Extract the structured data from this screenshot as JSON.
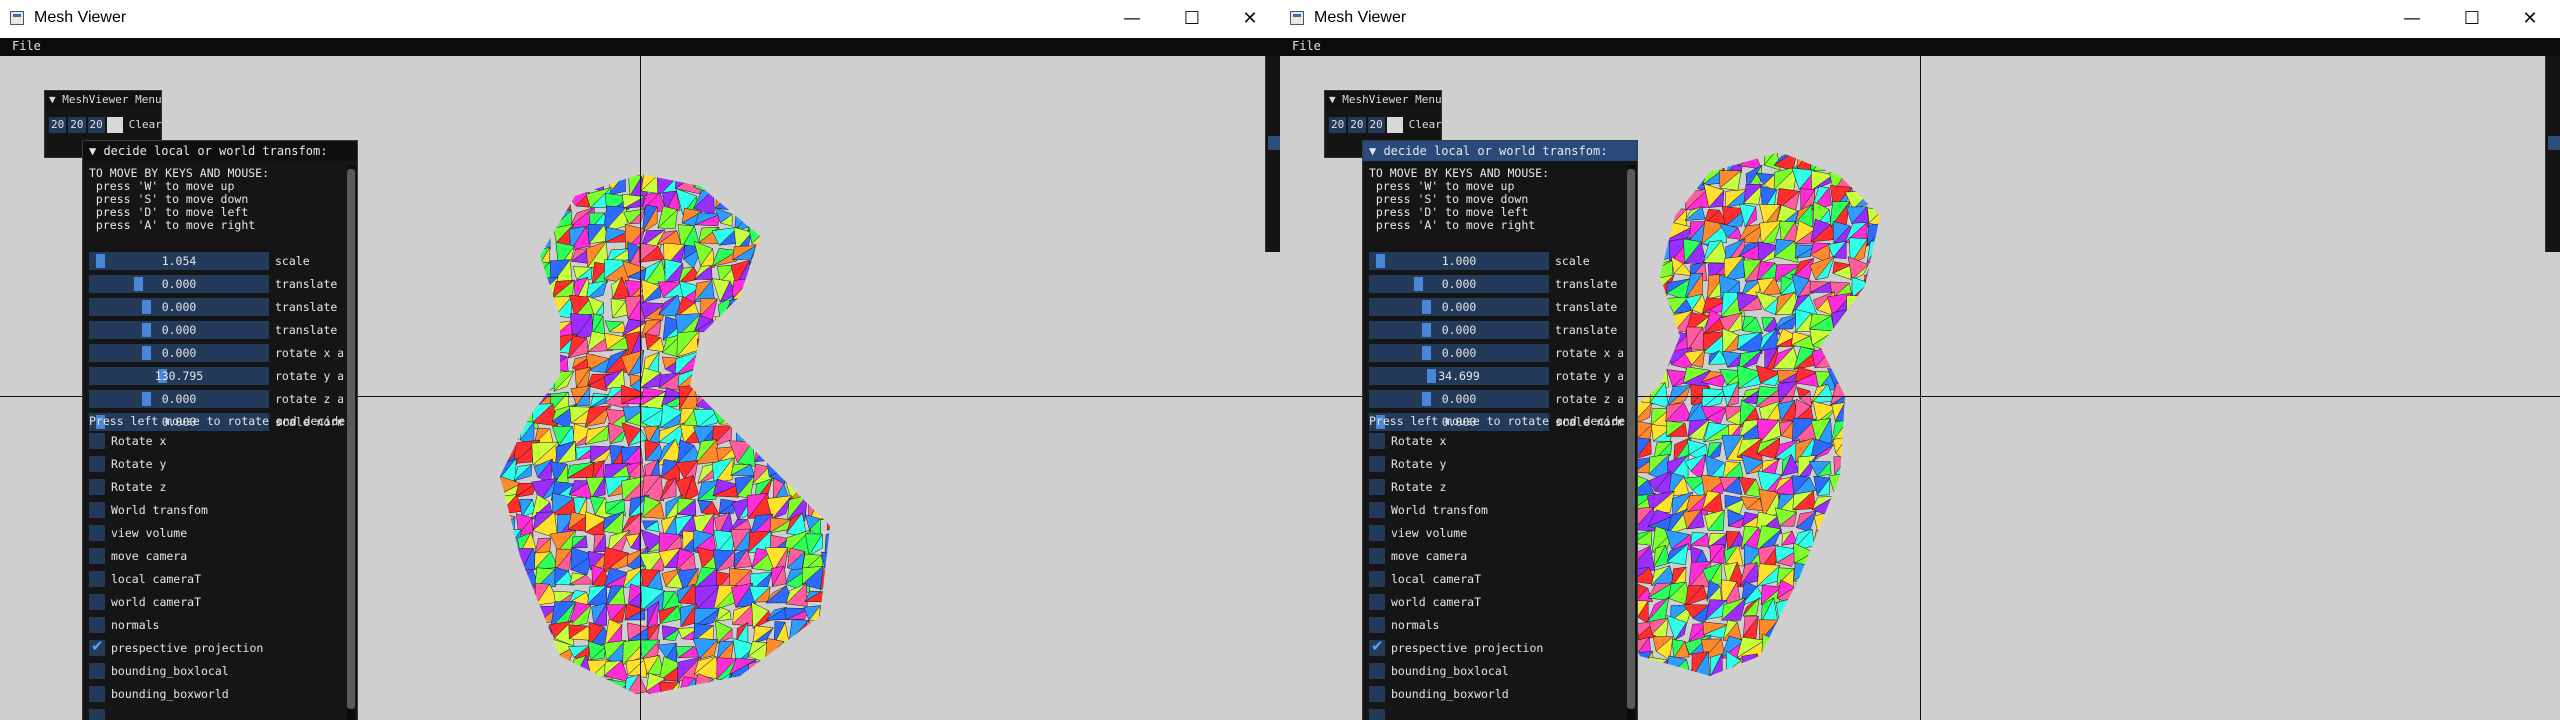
{
  "windows": [
    {
      "title": "Mesh Viewer",
      "controls": {
        "minimize": "—",
        "maximize": "☐",
        "close": "✕"
      },
      "menu": {
        "file": "File"
      },
      "small_window": {
        "title": "MeshViewer Menu",
        "values": [
          "20",
          "20",
          "20"
        ],
        "clear_label": "Clear"
      },
      "panel": {
        "title": "▼ decide local or world transfom:",
        "active": false,
        "help_lines": [
          "TO MOVE BY KEYS AND MOUSE:",
          " press 'W' to move up",
          " press 'S' to move down",
          " press 'D' to move left",
          " press 'A' to move right"
        ],
        "sliders": [
          {
            "value": "1.054",
            "label": "scale",
            "grab_fraction": 0.02
          },
          {
            "value": "0.000",
            "label": "translate x",
            "grab_fraction": 0.25
          },
          {
            "value": "0.000",
            "label": "translate y",
            "grab_fraction": 0.3
          },
          {
            "value": "0.000",
            "label": "translate z",
            "grab_fraction": 0.3
          },
          {
            "value": "0.000",
            "label": "rotate x axis",
            "grab_fraction": 0.3
          },
          {
            "value": "130.795",
            "label": "rotate y axis",
            "grab_fraction": 0.4
          },
          {
            "value": "0.000",
            "label": "rotate z axis",
            "grab_fraction": 0.3
          },
          {
            "value": "0.000",
            "label": "scale normals",
            "grab_fraction": 0.02
          }
        ],
        "press_text": "Press left mouse to rotate and decide",
        "checkboxes": [
          {
            "label": "Rotate x",
            "checked": false
          },
          {
            "label": "Rotate y",
            "checked": false
          },
          {
            "label": "Rotate z",
            "checked": false
          },
          {
            "label": "World transfom",
            "checked": false
          },
          {
            "label": "view volume",
            "checked": false
          },
          {
            "label": "move camera",
            "checked": false
          },
          {
            "label": "local cameraT",
            "checked": false
          },
          {
            "label": "world cameraT",
            "checked": false
          },
          {
            "label": "normals",
            "checked": false
          },
          {
            "label": "prespective projection",
            "checked": true
          },
          {
            "label": "bounding_boxlocal",
            "checked": false
          },
          {
            "label": "bounding_boxworld",
            "checked": false
          },
          {
            "label": "",
            "checked": false
          }
        ]
      }
    },
    {
      "title": "Mesh Viewer",
      "controls": {
        "minimize": "—",
        "maximize": "☐",
        "close": "✕"
      },
      "menu": {
        "file": "File"
      },
      "small_window": {
        "title": "MeshViewer Menu",
        "values": [
          "20",
          "20",
          "20"
        ],
        "clear_label": "Clear"
      },
      "panel": {
        "title": "▼ decide local or world transfom:",
        "active": true,
        "help_lines": [
          "TO MOVE BY KEYS AND MOUSE:",
          " press 'W' to move up",
          " press 'S' to move down",
          " press 'D' to move left",
          " press 'A' to move right"
        ],
        "sliders": [
          {
            "value": "1.000",
            "label": "scale",
            "grab_fraction": 0.02
          },
          {
            "value": "0.000",
            "label": "translate x",
            "grab_fraction": 0.25
          },
          {
            "value": "0.000",
            "label": "translate y",
            "grab_fraction": 0.3
          },
          {
            "value": "0.000",
            "label": "translate z",
            "grab_fraction": 0.3
          },
          {
            "value": "0.000",
            "label": "rotate x axis",
            "grab_fraction": 0.3
          },
          {
            "value": "34.699",
            "label": "rotate y axis",
            "grab_fraction": 0.33
          },
          {
            "value": "0.000",
            "label": "rotate z axis",
            "grab_fraction": 0.3
          },
          {
            "value": "0.000",
            "label": "scale normals",
            "grab_fraction": 0.02
          }
        ],
        "press_text": "Press left mouse to rotate and decide",
        "checkboxes": [
          {
            "label": "Rotate x",
            "checked": false
          },
          {
            "label": "Rotate y",
            "checked": false
          },
          {
            "label": "Rotate z",
            "checked": false
          },
          {
            "label": "World transfom",
            "checked": false
          },
          {
            "label": "view volume",
            "checked": false
          },
          {
            "label": "move camera",
            "checked": false
          },
          {
            "label": "local cameraT",
            "checked": false
          },
          {
            "label": "world cameraT",
            "checked": false
          },
          {
            "label": "normals",
            "checked": false
          },
          {
            "label": "prespective projection",
            "checked": true
          },
          {
            "label": "bounding_boxlocal",
            "checked": false
          },
          {
            "label": "bounding_boxworld",
            "checked": false
          },
          {
            "label": "",
            "checked": false
          }
        ]
      }
    }
  ],
  "colors": {
    "viewport_bg": "#cfcfcf",
    "panel_bg": "#151515",
    "frame_bg": "#243a5a",
    "accent": "#4a86d8",
    "checkmark": "#5ea0ff"
  }
}
